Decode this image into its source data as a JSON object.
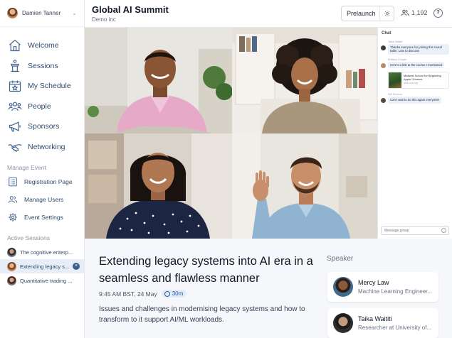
{
  "user": {
    "name": "Damien Tanner"
  },
  "nav": [
    {
      "label": "Welcome",
      "icon": "home-icon"
    },
    {
      "label": "Sessions",
      "icon": "podium-icon"
    },
    {
      "label": "My Schedule",
      "icon": "calendar-star-icon"
    },
    {
      "label": "People",
      "icon": "people-icon"
    },
    {
      "label": "Sponsors",
      "icon": "megaphone-icon"
    },
    {
      "label": "Networking",
      "icon": "handshake-icon"
    }
  ],
  "manage": {
    "title": "Manage Event",
    "items": [
      {
        "label": "Registration Page",
        "icon": "list-icon"
      },
      {
        "label": "Manage Users",
        "icon": "users-icon"
      },
      {
        "label": "Event Settings",
        "icon": "gear-icon"
      }
    ]
  },
  "active_sessions": {
    "title": "Active Sessions",
    "items": [
      {
        "label": "The cognitive enterp...",
        "active": false
      },
      {
        "label": "Extending legacy s...",
        "active": true
      },
      {
        "label": "Quantitative trading ...",
        "active": false
      }
    ]
  },
  "header": {
    "title": "Global AI Summit",
    "org": "Demo inc",
    "prelaunch_label": "Prelaunch",
    "attendee_count": "1,192",
    "help_label": "?"
  },
  "chat": {
    "title": "Chat",
    "messages": [
      {
        "author": "Taika Waititi",
        "text": "Thanks everyone for joining this round table. Lots to discuss!"
      },
      {
        "author": "Brittany Cooper",
        "text": "Here's a link to the course I mentioned"
      },
      {
        "author": "Will Benson",
        "text": "Can't wait to do this again everyone!"
      }
    ],
    "link_card": {
      "title": "Midwest School for Beginning Apple Growers",
      "url": "ahls.ucdl.org"
    },
    "input_placeholder": "Message group"
  },
  "session": {
    "title": "Extending legacy systems into AI era in a seamless and flawless manner",
    "time": "9:45 AM BST, 24 May",
    "duration": "30m",
    "description": "Issues and challenges in modernising legacy systems and how to transform to it support AI/ML workloads."
  },
  "speakers": {
    "heading": "Speaker",
    "items": [
      {
        "name": "Mercy Law",
        "role": "Machine Learning Engineer..."
      },
      {
        "name": "Taika Waititi",
        "role": "Researcher at University of..."
      }
    ]
  }
}
